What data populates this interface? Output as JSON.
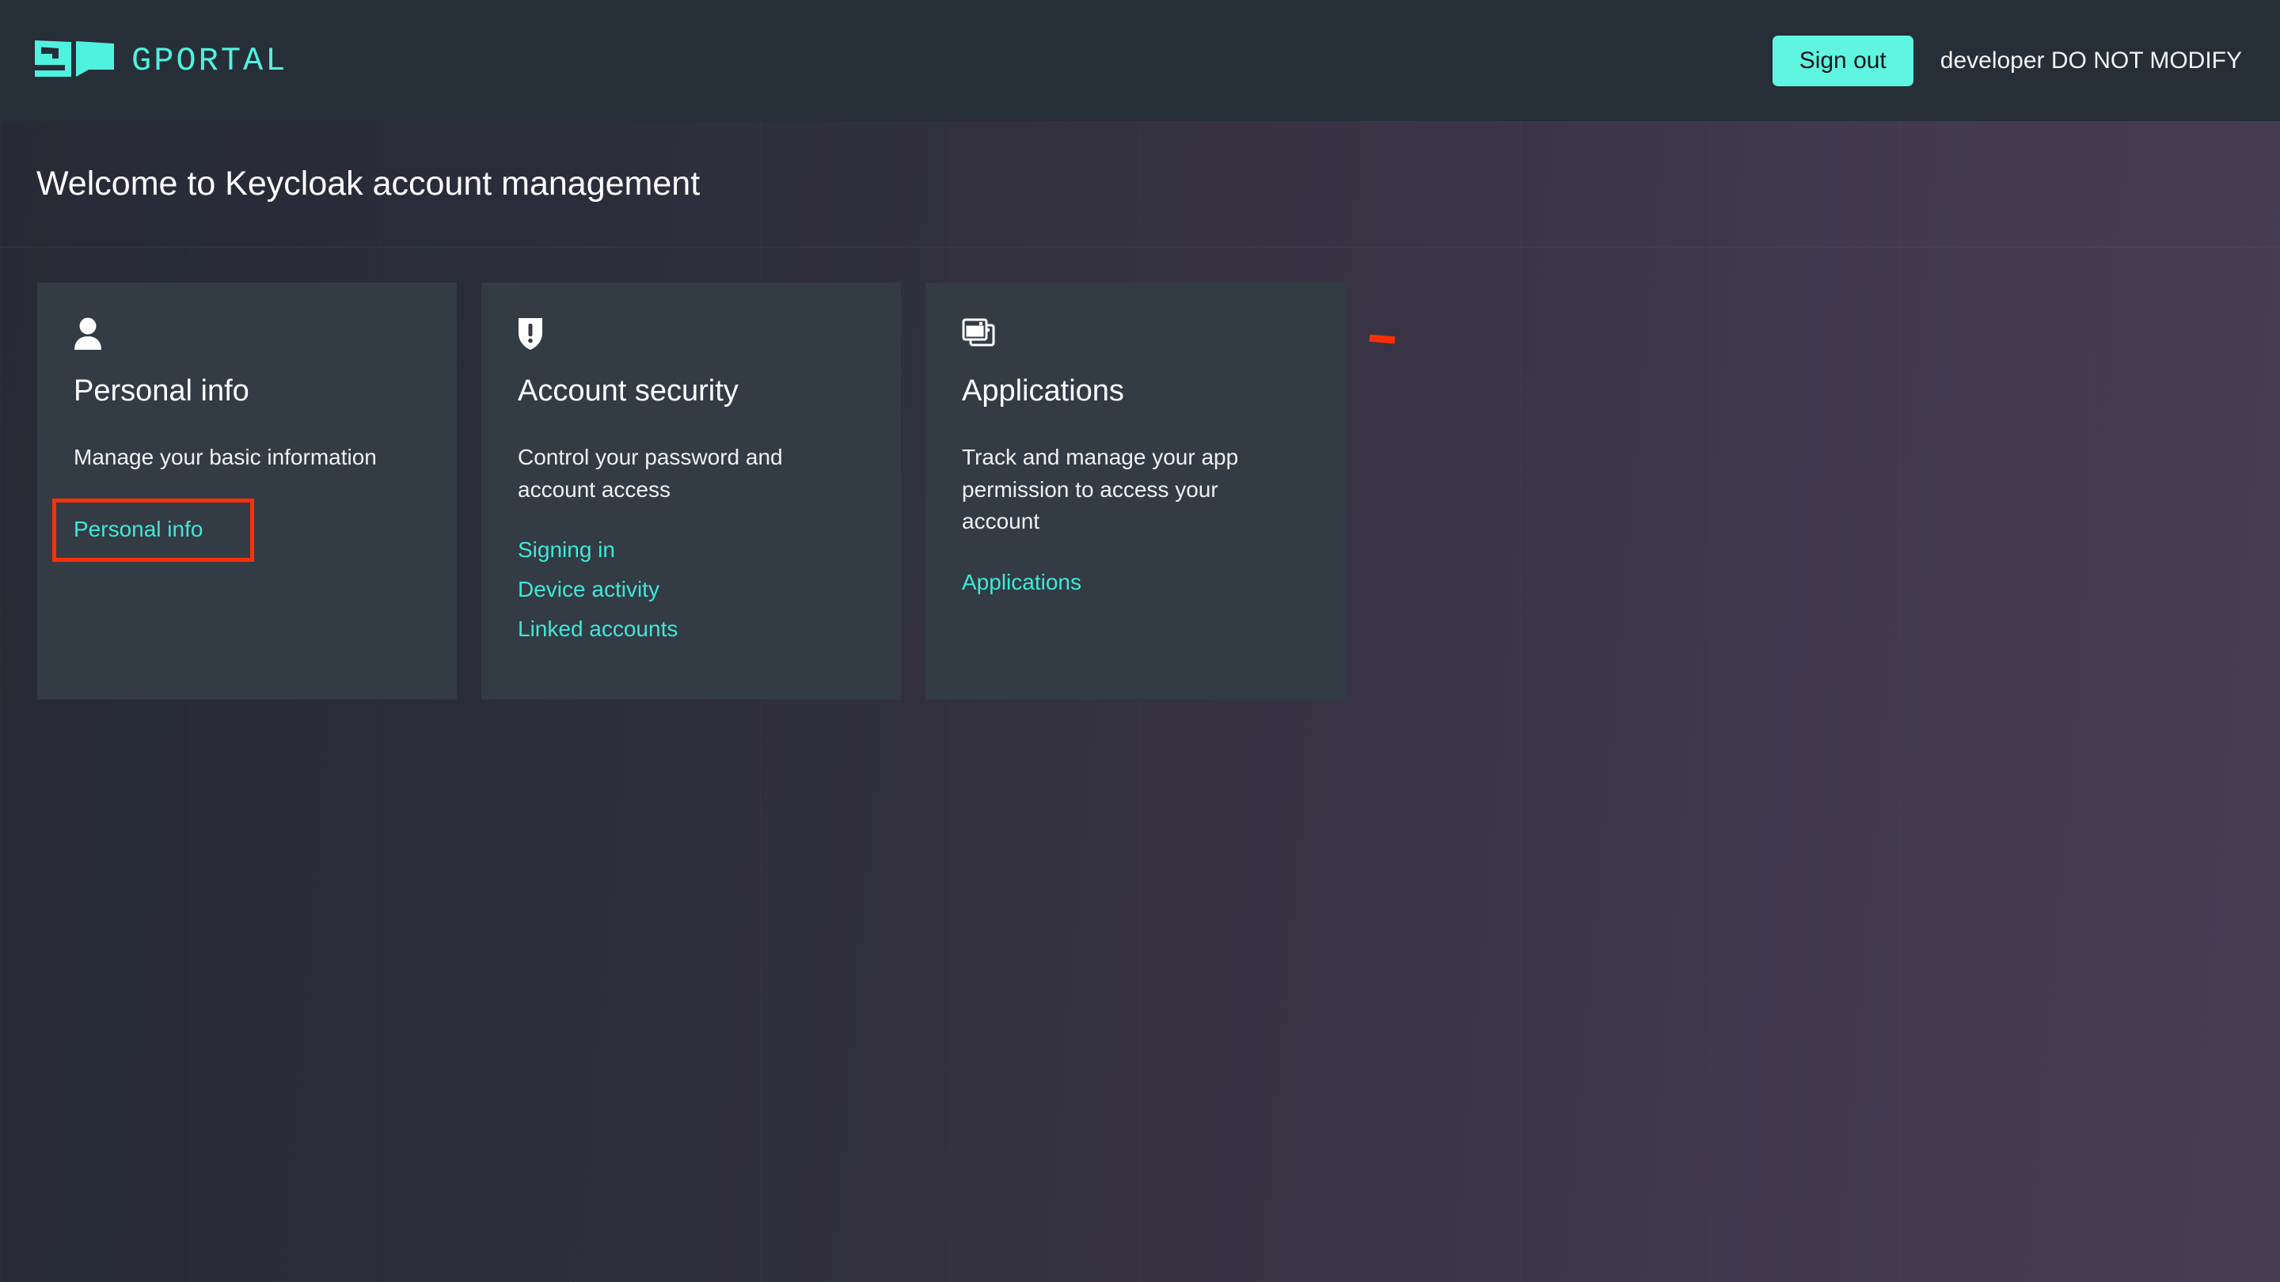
{
  "header": {
    "brand_name": "GPORTAL",
    "brand_icon": "gportal-logo-icon",
    "signout_label": "Sign out",
    "username": "developer DO NOT MODIFY"
  },
  "welcome": {
    "title": "Welcome to Keycloak account management"
  },
  "cards": [
    {
      "icon": "user-icon",
      "title": "Personal info",
      "description": "Manage your basic information",
      "links": [
        {
          "label": "Personal info",
          "highlighted": true
        }
      ]
    },
    {
      "icon": "shield-exclamation-icon",
      "title": "Account security",
      "description": "Control your password and account access",
      "links": [
        {
          "label": "Signing in",
          "highlighted": false
        },
        {
          "label": "Device activity",
          "highlighted": false
        },
        {
          "label": "Linked accounts",
          "highlighted": false
        }
      ]
    },
    {
      "icon": "windows-stack-icon",
      "title": "Applications",
      "description": "Track and manage your app permission to access your account",
      "links": [
        {
          "label": "Applications",
          "highlighted": false
        }
      ]
    }
  ],
  "colors": {
    "brand_accent": "#4ff2de",
    "link": "#3fe8d8",
    "button_bg": "#5ff5e0",
    "card_bg": "#333b44",
    "header_bg": "#262e38",
    "annotation": "#fb3009"
  },
  "annotation": {
    "dash": "red-annotation-dash"
  }
}
